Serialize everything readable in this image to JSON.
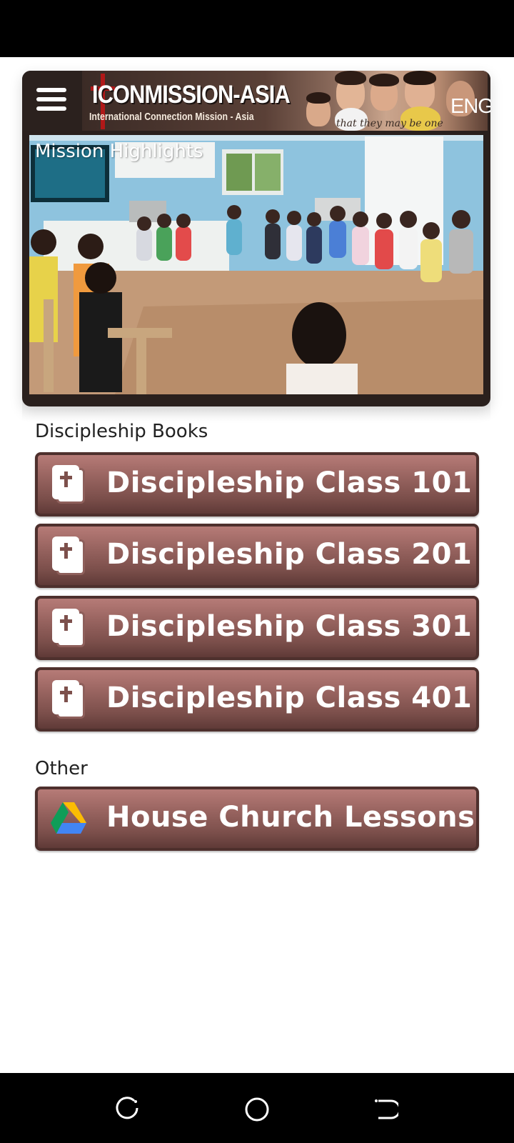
{
  "header": {
    "banner_title": "ICONMISSION-ASIA",
    "banner_subtitle": "International Connection Mission - Asia",
    "banner_script": "that they may be one",
    "language": "ENG"
  },
  "highlights": {
    "caption": "Mission Highlights"
  },
  "sections": {
    "discipleship_label": "Discipleship Books",
    "other_label": "Other"
  },
  "buttons": {
    "class_101": "Discipleship Class 101",
    "class_201": "Discipleship Class 201",
    "class_301": "Discipleship Class 301",
    "class_401": "Discipleship Class 401",
    "house_church": "House Church Lessons"
  },
  "icons": {
    "menu": "hamburger-icon",
    "book": "bible-icon",
    "drive": "google-drive-icon",
    "recents": "recents-icon",
    "home": "home-icon",
    "back": "back-icon"
  },
  "colors": {
    "button_top": "#b67b77",
    "button_bottom": "#5f3a37",
    "button_border": "#4e302d",
    "header_bg": "#2b211e"
  }
}
